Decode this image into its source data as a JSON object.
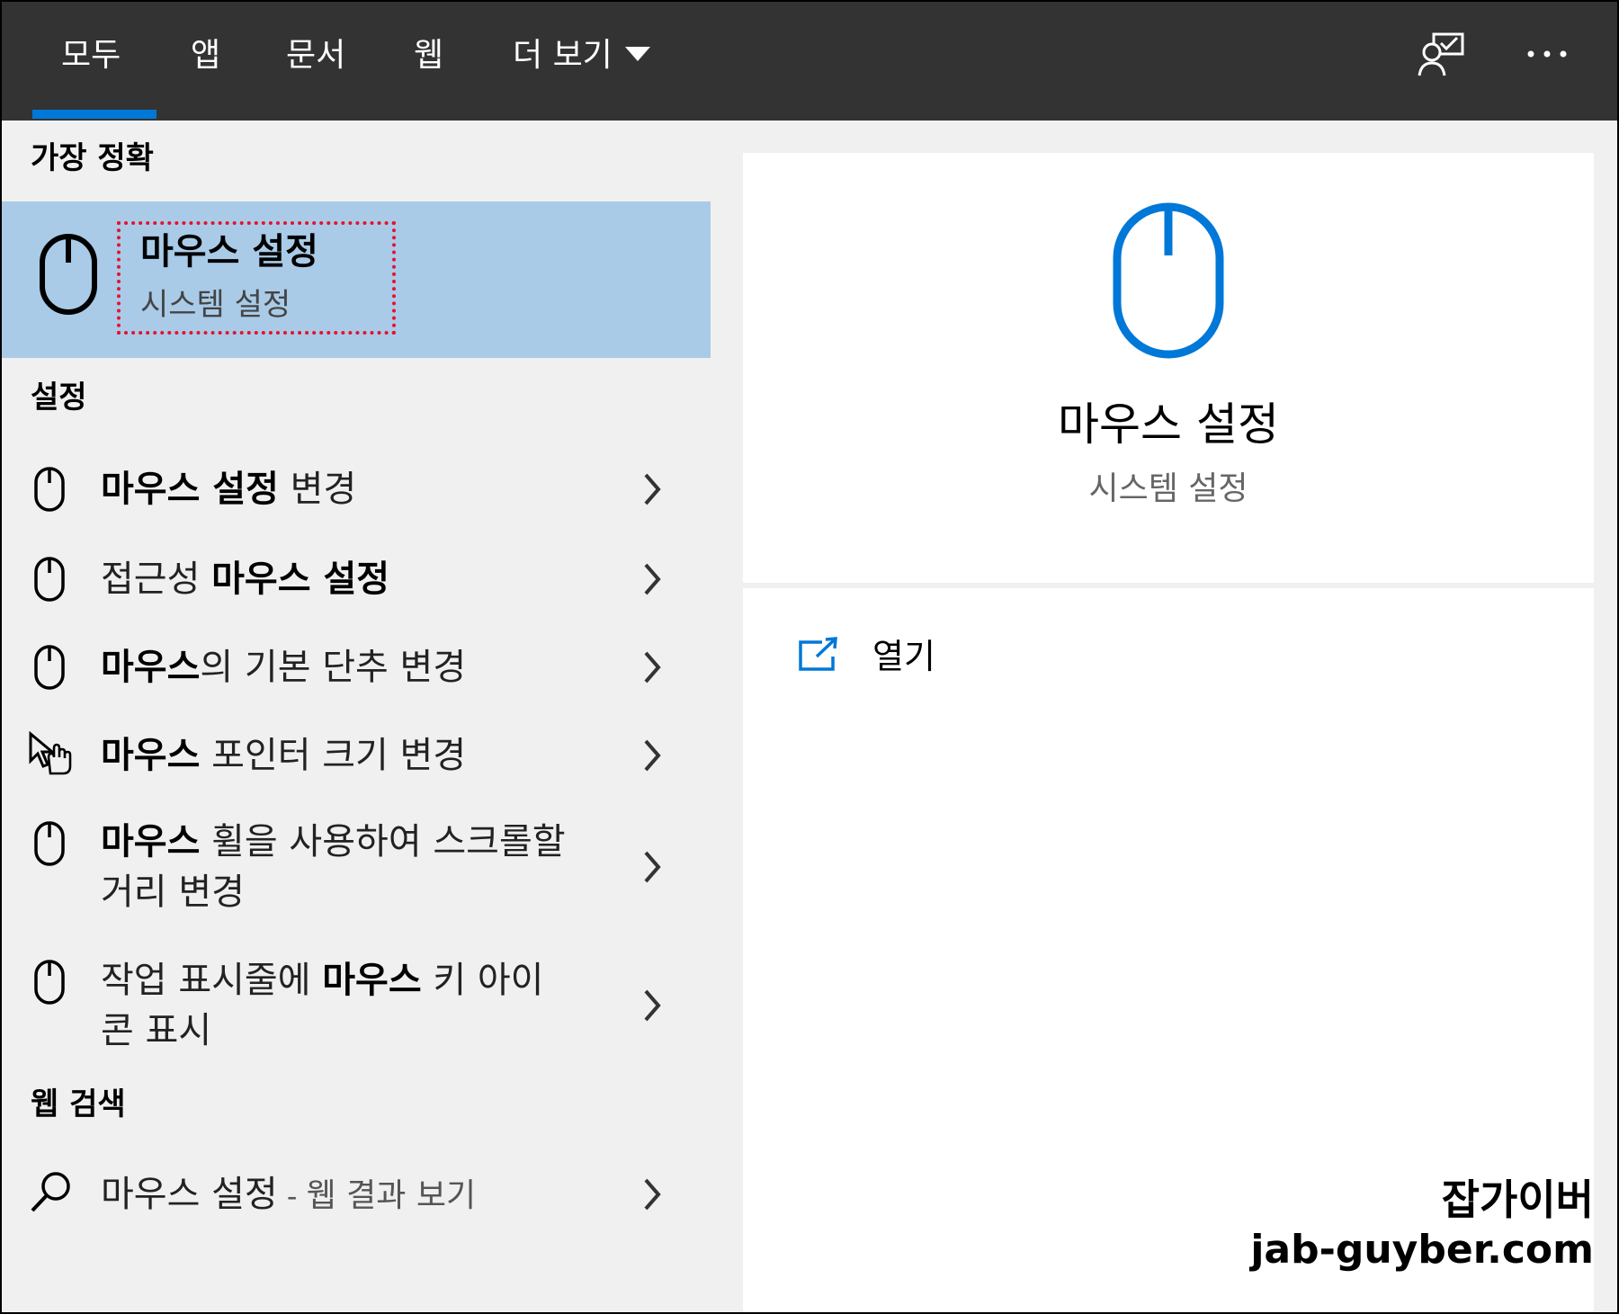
{
  "tabs": {
    "all": "모두",
    "apps": "앱",
    "documents": "문서",
    "web": "웹",
    "more": "더 보기"
  },
  "sections": {
    "best_match": "가장 정확",
    "settings": "설정",
    "web_search": "웹 검색"
  },
  "best_match": {
    "title": "마우스 설정",
    "subtitle": "시스템 설정",
    "icon": "mouse-icon"
  },
  "settings_results": [
    {
      "icon": "mouse-icon",
      "bold": "마우스 설정",
      "rest": " 변경"
    },
    {
      "icon": "mouse-icon",
      "pre": "접근성 ",
      "bold": "마우스 설정"
    },
    {
      "icon": "mouse-icon",
      "bold": "마우스",
      "rest": "의 기본 단추 변경"
    },
    {
      "icon": "pointer-hand-icon",
      "bold": "마우스",
      "rest": " 포인터 크기 변경"
    },
    {
      "icon": "mouse-icon",
      "bold": "마우스",
      "rest": " 휠을 사용하여 스크롤할 거리 변경"
    },
    {
      "icon": "mouse-icon",
      "pre": "작업 표시줄에 ",
      "bold": "마우스",
      "rest": " 키 아이콘 표시"
    }
  ],
  "web_result": {
    "query": "마우스 설정",
    "dash": " - ",
    "suffix": "웹 결과 보기",
    "icon": "search-icon"
  },
  "preview": {
    "title": "마우스 설정",
    "subtitle": "시스템 설정",
    "open_label": "열기",
    "icon": "mouse-icon"
  },
  "watermark": {
    "line1": "잡가이버",
    "line2": "jab-guyber.com"
  },
  "colors": {
    "topbar": "#333333",
    "accent": "#0078d7",
    "selected": "#a9cbe8",
    "highlight_border": "#e8112d"
  }
}
